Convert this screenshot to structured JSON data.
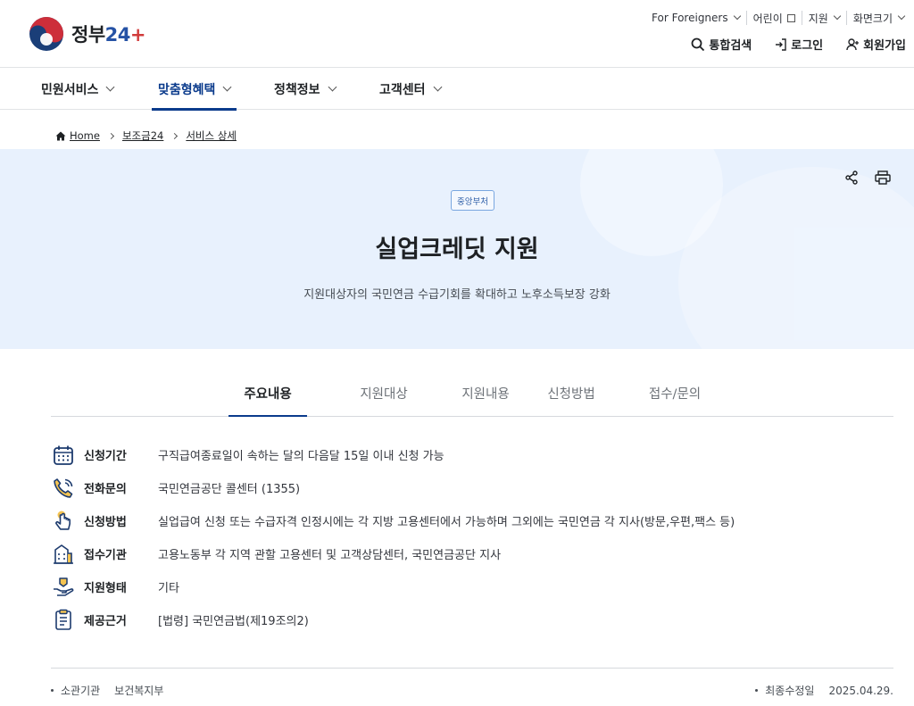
{
  "brand": {
    "name_ko": "정부",
    "name_num": "2",
    "name_num2": "4"
  },
  "utility": [
    {
      "label": "For Foreigners",
      "icon": "chevron-down-icon"
    },
    {
      "label": "어린이",
      "icon": "external-link-icon"
    },
    {
      "label": "지원",
      "icon": "chevron-down-icon"
    },
    {
      "label": "화면크기",
      "icon": "chevron-down-icon"
    }
  ],
  "actions": {
    "search": "통합검색",
    "login": "로그인",
    "signup": "회원가입"
  },
  "nav": [
    {
      "label": "민원서비스"
    },
    {
      "label": "맞춤형혜택"
    },
    {
      "label": "정책정보"
    },
    {
      "label": "고객센터"
    }
  ],
  "nav_active_index": 1,
  "breadcrumb": {
    "home": "Home",
    "level1": "보조금24",
    "level2": "서비스 상세"
  },
  "hero": {
    "badge": "중앙부처",
    "title": "실업크레딧 지원",
    "subtitle": "지원대상자의 국민연금 수급기회를 확대하고 노후소득보장 강화"
  },
  "tabs": [
    {
      "label": "주요내용"
    },
    {
      "label": "지원대상"
    },
    {
      "label": "지원내용"
    },
    {
      "label": "신청방법"
    },
    {
      "label": "접수/문의"
    }
  ],
  "tab_active_index": 0,
  "info": [
    {
      "icon": "calendar-icon",
      "label": "신청기간",
      "value": "구직급여종료일이 속하는 달의 다음달 15일 이내 신청 가능"
    },
    {
      "icon": "phone-icon",
      "label": "전화문의",
      "value": "국민연금공단 콜센터 (1355)"
    },
    {
      "icon": "touch-hand-icon",
      "label": "신청방법",
      "value": "실업급여 신청 또는 수급자격 인정시에는 각 지방 고용센터에서 가능하며 그외에는 국민연금 각 지사(방문,우편,팩스 등)"
    },
    {
      "icon": "building-icon",
      "label": "접수기관",
      "value": "고용노동부 각 지역 관할 고용센터 및 고객상담센터, 국민연금공단 지사"
    },
    {
      "icon": "support-hand-icon",
      "label": "지원형태",
      "value": "기타"
    },
    {
      "icon": "document-list-icon",
      "label": "제공근거",
      "value": "[법령] 국민연금법(제19조의2)"
    }
  ],
  "meta": {
    "agency_label": "소관기관",
    "agency_value": "보건복지부",
    "updated_label": "최종수정일",
    "updated_value": "2025.04.29."
  },
  "colors": {
    "primary": "#0b3b8c",
    "hero_bg": "#e8f1fd",
    "text": "#1e2124"
  }
}
